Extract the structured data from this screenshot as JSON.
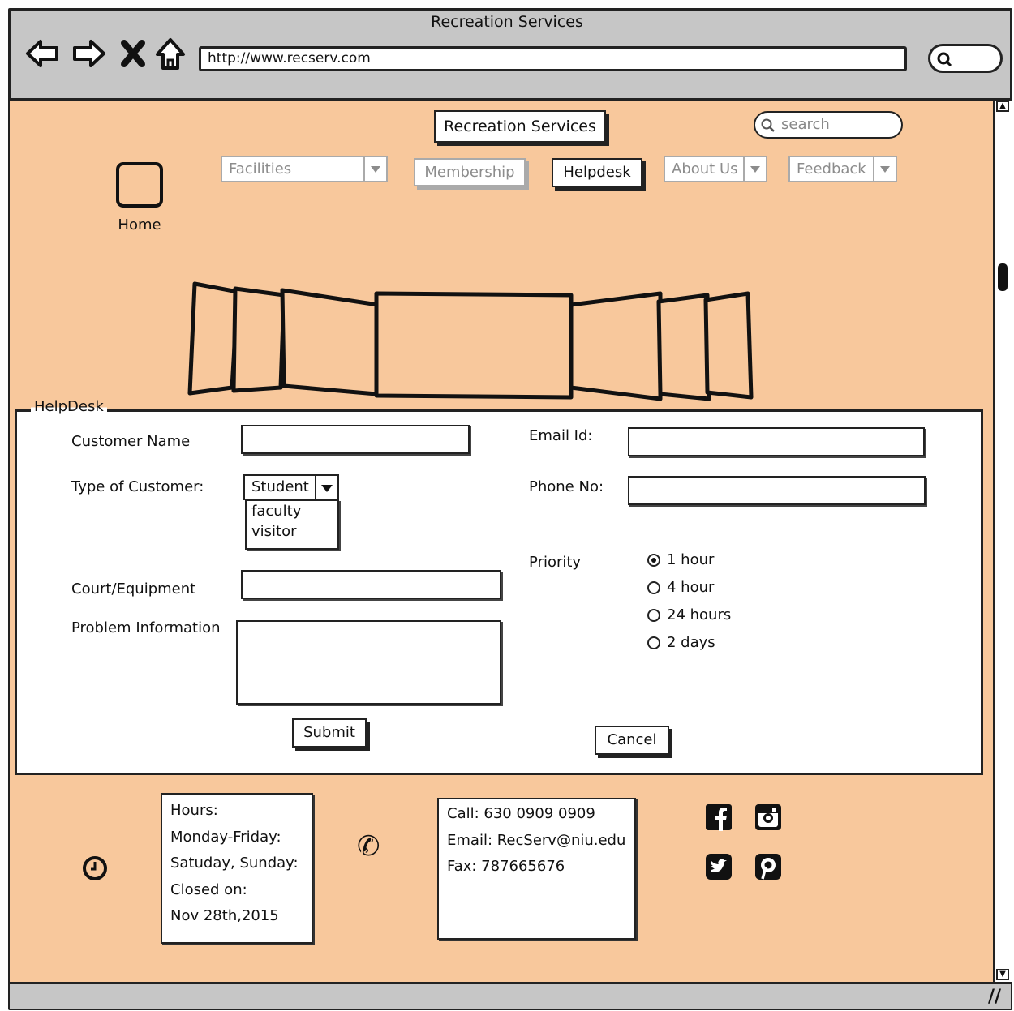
{
  "browser": {
    "window_title": "Recreation Services",
    "url": "http://www.recserv.com",
    "back_glyph": "⇦",
    "forward_glyph": "⇨",
    "stop_glyph": "✖",
    "home_glyph": "⇧"
  },
  "header": {
    "site_title": "Recreation Services",
    "search_placeholder": "search"
  },
  "nav": {
    "home_label": "Home",
    "items": [
      {
        "label": "Facilities",
        "has_dropdown": true,
        "state": "disabled"
      },
      {
        "label": "Membership",
        "has_dropdown": false,
        "state": "disabled"
      },
      {
        "label": "Helpdesk",
        "has_dropdown": false,
        "state": "selected"
      },
      {
        "label": "About Us",
        "has_dropdown": true,
        "state": "disabled"
      },
      {
        "label": "Feedback",
        "has_dropdown": true,
        "state": "disabled"
      }
    ]
  },
  "form": {
    "legend": "HelpDesk",
    "customer_name_label": "Customer Name",
    "type_label": "Type of Customer:",
    "type_selected": "Student",
    "type_options": [
      "faculty",
      "visitor"
    ],
    "court_label": "Court/Equipment",
    "problem_label": "Problem Information",
    "email_label": "Email Id:",
    "phone_label": "Phone No:",
    "priority_label": "Priority",
    "priority_options": [
      {
        "label": "1 hour",
        "selected": true
      },
      {
        "label": "4 hour",
        "selected": false
      },
      {
        "label": "24 hours",
        "selected": false
      },
      {
        "label": "2 days",
        "selected": false
      }
    ],
    "submit_label": "Submit",
    "cancel_label": "Cancel"
  },
  "footer": {
    "hours_lines": [
      "Hours:",
      "Monday-Friday:",
      "Satuday, Sunday:",
      "Closed on:",
      "Nov 28th,2015"
    ],
    "contact_lines": [
      "Call: 630 0909 0909",
      "Email: RecServ@niu.edu",
      "Fax: 787665676"
    ],
    "phone_glyph": "✆",
    "social_icons": [
      "facebook-icon",
      "instagram-icon",
      "twitter-icon",
      "pinterest-icon"
    ]
  },
  "colors": {
    "page_background": "#f8c89c",
    "chrome": "#c6c6c6",
    "ink": "#111111",
    "disabled": "#8c8c8c"
  }
}
